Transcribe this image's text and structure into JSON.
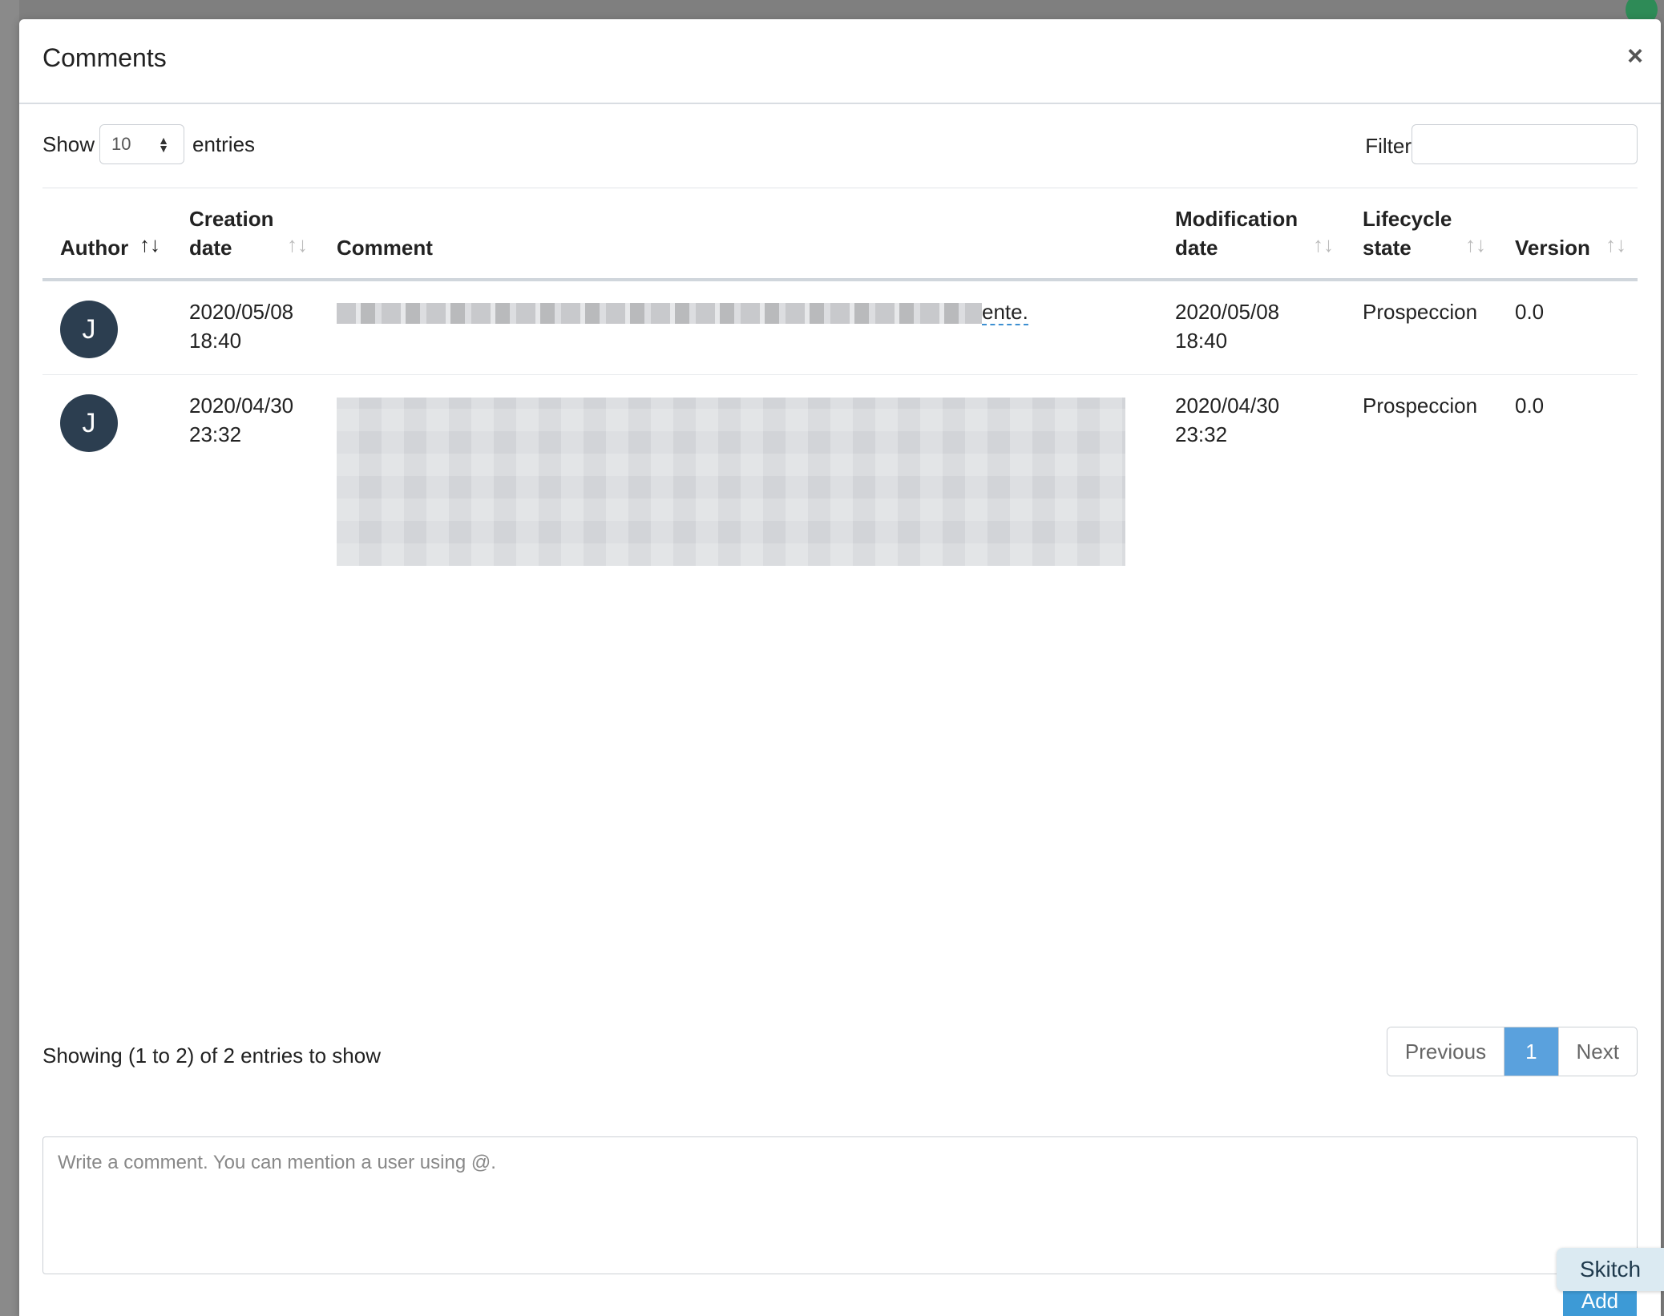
{
  "modal": {
    "title": "Comments",
    "close_glyph": "×"
  },
  "controls": {
    "show_label": "Show",
    "entries_value": "10",
    "entries_label": "entries",
    "filter_label": "Filter"
  },
  "table": {
    "headers": {
      "author": "Author",
      "creation_l1": "Creation",
      "creation_l2": "date",
      "comment": "Comment",
      "modification_l1": "Modification",
      "modification_l2": "date",
      "lifecycle_l1": "Lifecycle",
      "lifecycle_l2": "state",
      "version": "Version"
    },
    "rows": [
      {
        "avatar": "J",
        "created_date": "2020/05/08",
        "created_time": "18:40",
        "comment_tail": "ente.",
        "modified_date": "2020/05/08",
        "modified_time": "18:40",
        "state": "Prospeccion",
        "version": "0.0"
      },
      {
        "avatar": "J",
        "created_date": "2020/04/30",
        "created_time": "23:32",
        "comment_tail": "",
        "modified_date": "2020/04/30",
        "modified_time": "23:32",
        "state": "Prospeccion",
        "version": "0.0"
      }
    ]
  },
  "footer": {
    "info": "Showing (1 to 2) of 2 entries to show",
    "prev": "Previous",
    "page": "1",
    "next": "Next"
  },
  "composer": {
    "placeholder": "Write a comment. You can mention a user using @.",
    "add_label": "Add"
  },
  "skitch": {
    "label": "Skitch"
  }
}
